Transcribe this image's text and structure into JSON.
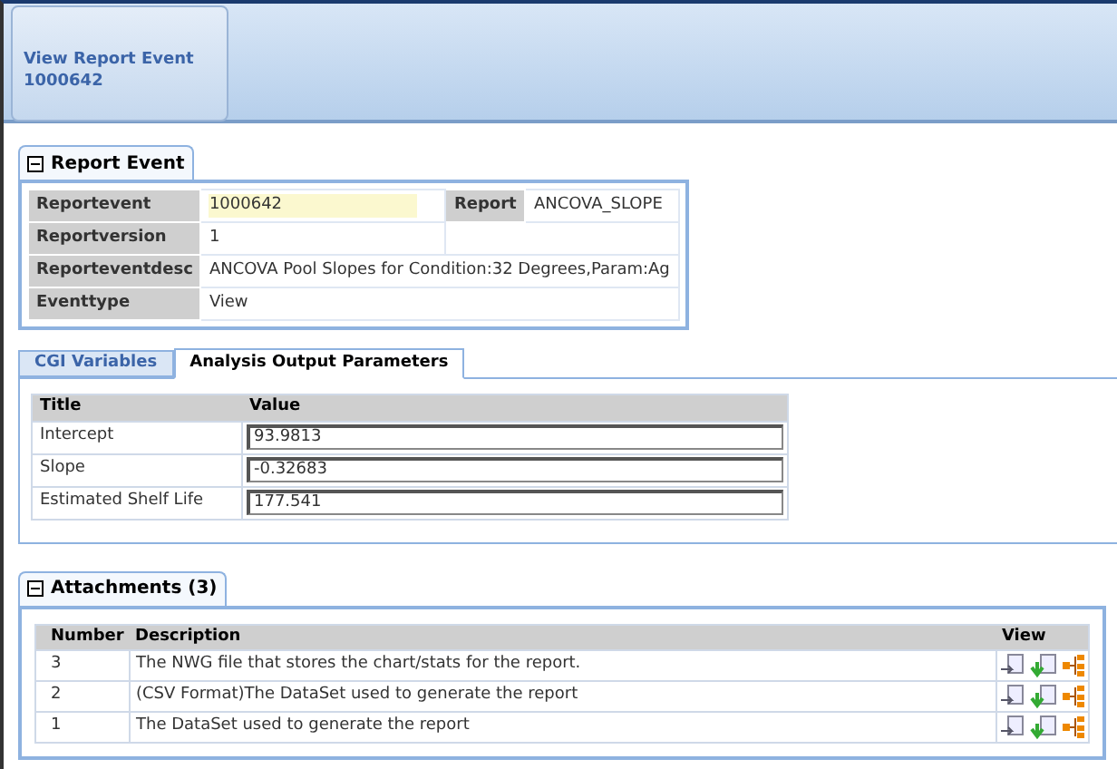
{
  "header": {
    "title": "View Report Event",
    "subtitle": "1000642"
  },
  "report_event": {
    "title": "Report Event",
    "expanded": true,
    "rows": [
      {
        "label": "Reportevent",
        "value": "1000642",
        "label2": "Report",
        "value2": "ANCOVA_SLOPE"
      },
      {
        "label": "Reportversion",
        "value": "1",
        "label2": "",
        "value2": ""
      },
      {
        "label": "Reporteventdesc",
        "value": "ANCOVA Pool Slopes for Condition:32 Degrees,Param:Ag"
      },
      {
        "label": "Eventtype",
        "value": "View"
      }
    ]
  },
  "tabs": [
    {
      "label": "CGI Variables",
      "selected": false
    },
    {
      "label": "Analysis Output Parameters",
      "selected": true
    }
  ],
  "parameters": {
    "columns": [
      "Title",
      "Value"
    ],
    "rows": [
      {
        "title": "Intercept",
        "value": "93.9813"
      },
      {
        "title": "Slope",
        "value": "-0.32683"
      },
      {
        "title": "Estimated Shelf Life",
        "value": "177.541"
      }
    ]
  },
  "attachments": {
    "title": "Attachments (3)",
    "expanded": true,
    "columns": [
      "Number",
      "Description",
      "View"
    ],
    "rows": [
      {
        "number": "3",
        "description": "The NWG file that stores the chart/stats for the report."
      },
      {
        "number": "2",
        "description": "(CSV Format)The DataSet used to generate the report"
      },
      {
        "number": "1",
        "description": "The DataSet used to generate the report"
      }
    ]
  }
}
